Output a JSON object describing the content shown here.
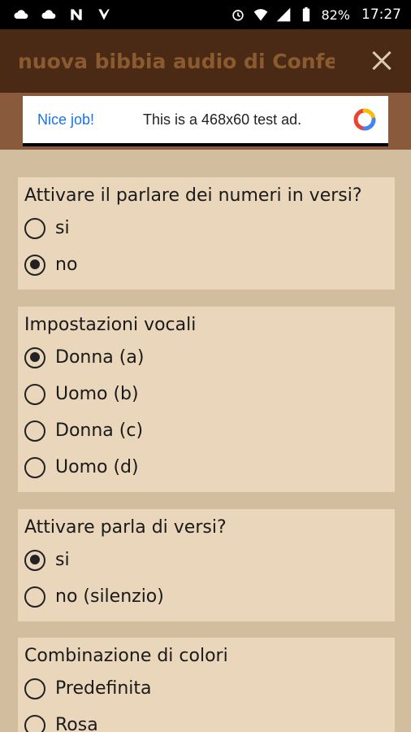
{
  "status_bar": {
    "battery_percent": "82%",
    "time": "17:27",
    "icons": [
      "cloud-icon",
      "cloud-icon",
      "n-icon",
      "check-icon",
      "alarm-icon",
      "wifi-icon",
      "signal-icon",
      "battery-icon"
    ]
  },
  "app_bar": {
    "title": "nuova bibbia audio di Confer...",
    "close_icon": "close-icon"
  },
  "ad": {
    "nice": "Nice job!",
    "text": "This is a 468x60 test ad."
  },
  "settings": [
    {
      "title": "Attivare il parlare dei numeri in versi?",
      "options": [
        {
          "label": "si",
          "selected": false
        },
        {
          "label": "no",
          "selected": true
        }
      ]
    },
    {
      "title": "Impostazioni vocali",
      "options": [
        {
          "label": "Donna (a)",
          "selected": true
        },
        {
          "label": "Uomo (b)",
          "selected": false
        },
        {
          "label": "Donna (c)",
          "selected": false
        },
        {
          "label": "Uomo (d)",
          "selected": false
        }
      ]
    },
    {
      "title": "Attivare parla di versi?",
      "options": [
        {
          "label": "si",
          "selected": true
        },
        {
          "label": "no (silenzio)",
          "selected": false
        }
      ]
    },
    {
      "title": "Combinazione di colori",
      "options": [
        {
          "label": "Predefinita",
          "selected": false
        },
        {
          "label": "Rosa",
          "selected": false
        }
      ]
    }
  ],
  "colors": {
    "background": "#d3bd9f",
    "card": "#ead6bb",
    "app_bar": "#4a2a14",
    "title_text": "#8a5a30"
  }
}
